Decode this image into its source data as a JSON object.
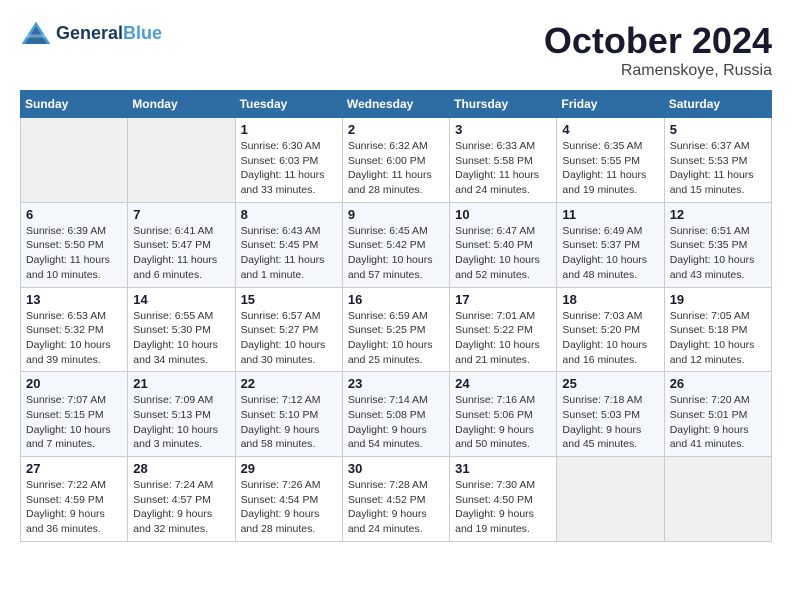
{
  "header": {
    "logo_line1": "General",
    "logo_line2": "Blue",
    "month": "October 2024",
    "location": "Ramenskoye, Russia"
  },
  "days_of_week": [
    "Sunday",
    "Monday",
    "Tuesday",
    "Wednesday",
    "Thursday",
    "Friday",
    "Saturday"
  ],
  "weeks": [
    [
      {
        "day": "",
        "empty": true
      },
      {
        "day": "",
        "empty": true
      },
      {
        "day": "1",
        "sunrise": "Sunrise: 6:30 AM",
        "sunset": "Sunset: 6:03 PM",
        "daylight": "Daylight: 11 hours and 33 minutes."
      },
      {
        "day": "2",
        "sunrise": "Sunrise: 6:32 AM",
        "sunset": "Sunset: 6:00 PM",
        "daylight": "Daylight: 11 hours and 28 minutes."
      },
      {
        "day": "3",
        "sunrise": "Sunrise: 6:33 AM",
        "sunset": "Sunset: 5:58 PM",
        "daylight": "Daylight: 11 hours and 24 minutes."
      },
      {
        "day": "4",
        "sunrise": "Sunrise: 6:35 AM",
        "sunset": "Sunset: 5:55 PM",
        "daylight": "Daylight: 11 hours and 19 minutes."
      },
      {
        "day": "5",
        "sunrise": "Sunrise: 6:37 AM",
        "sunset": "Sunset: 5:53 PM",
        "daylight": "Daylight: 11 hours and 15 minutes."
      }
    ],
    [
      {
        "day": "6",
        "sunrise": "Sunrise: 6:39 AM",
        "sunset": "Sunset: 5:50 PM",
        "daylight": "Daylight: 11 hours and 10 minutes."
      },
      {
        "day": "7",
        "sunrise": "Sunrise: 6:41 AM",
        "sunset": "Sunset: 5:47 PM",
        "daylight": "Daylight: 11 hours and 6 minutes."
      },
      {
        "day": "8",
        "sunrise": "Sunrise: 6:43 AM",
        "sunset": "Sunset: 5:45 PM",
        "daylight": "Daylight: 11 hours and 1 minute."
      },
      {
        "day": "9",
        "sunrise": "Sunrise: 6:45 AM",
        "sunset": "Sunset: 5:42 PM",
        "daylight": "Daylight: 10 hours and 57 minutes."
      },
      {
        "day": "10",
        "sunrise": "Sunrise: 6:47 AM",
        "sunset": "Sunset: 5:40 PM",
        "daylight": "Daylight: 10 hours and 52 minutes."
      },
      {
        "day": "11",
        "sunrise": "Sunrise: 6:49 AM",
        "sunset": "Sunset: 5:37 PM",
        "daylight": "Daylight: 10 hours and 48 minutes."
      },
      {
        "day": "12",
        "sunrise": "Sunrise: 6:51 AM",
        "sunset": "Sunset: 5:35 PM",
        "daylight": "Daylight: 10 hours and 43 minutes."
      }
    ],
    [
      {
        "day": "13",
        "sunrise": "Sunrise: 6:53 AM",
        "sunset": "Sunset: 5:32 PM",
        "daylight": "Daylight: 10 hours and 39 minutes."
      },
      {
        "day": "14",
        "sunrise": "Sunrise: 6:55 AM",
        "sunset": "Sunset: 5:30 PM",
        "daylight": "Daylight: 10 hours and 34 minutes."
      },
      {
        "day": "15",
        "sunrise": "Sunrise: 6:57 AM",
        "sunset": "Sunset: 5:27 PM",
        "daylight": "Daylight: 10 hours and 30 minutes."
      },
      {
        "day": "16",
        "sunrise": "Sunrise: 6:59 AM",
        "sunset": "Sunset: 5:25 PM",
        "daylight": "Daylight: 10 hours and 25 minutes."
      },
      {
        "day": "17",
        "sunrise": "Sunrise: 7:01 AM",
        "sunset": "Sunset: 5:22 PM",
        "daylight": "Daylight: 10 hours and 21 minutes."
      },
      {
        "day": "18",
        "sunrise": "Sunrise: 7:03 AM",
        "sunset": "Sunset: 5:20 PM",
        "daylight": "Daylight: 10 hours and 16 minutes."
      },
      {
        "day": "19",
        "sunrise": "Sunrise: 7:05 AM",
        "sunset": "Sunset: 5:18 PM",
        "daylight": "Daylight: 10 hours and 12 minutes."
      }
    ],
    [
      {
        "day": "20",
        "sunrise": "Sunrise: 7:07 AM",
        "sunset": "Sunset: 5:15 PM",
        "daylight": "Daylight: 10 hours and 7 minutes."
      },
      {
        "day": "21",
        "sunrise": "Sunrise: 7:09 AM",
        "sunset": "Sunset: 5:13 PM",
        "daylight": "Daylight: 10 hours and 3 minutes."
      },
      {
        "day": "22",
        "sunrise": "Sunrise: 7:12 AM",
        "sunset": "Sunset: 5:10 PM",
        "daylight": "Daylight: 9 hours and 58 minutes."
      },
      {
        "day": "23",
        "sunrise": "Sunrise: 7:14 AM",
        "sunset": "Sunset: 5:08 PM",
        "daylight": "Daylight: 9 hours and 54 minutes."
      },
      {
        "day": "24",
        "sunrise": "Sunrise: 7:16 AM",
        "sunset": "Sunset: 5:06 PM",
        "daylight": "Daylight: 9 hours and 50 minutes."
      },
      {
        "day": "25",
        "sunrise": "Sunrise: 7:18 AM",
        "sunset": "Sunset: 5:03 PM",
        "daylight": "Daylight: 9 hours and 45 minutes."
      },
      {
        "day": "26",
        "sunrise": "Sunrise: 7:20 AM",
        "sunset": "Sunset: 5:01 PM",
        "daylight": "Daylight: 9 hours and 41 minutes."
      }
    ],
    [
      {
        "day": "27",
        "sunrise": "Sunrise: 7:22 AM",
        "sunset": "Sunset: 4:59 PM",
        "daylight": "Daylight: 9 hours and 36 minutes."
      },
      {
        "day": "28",
        "sunrise": "Sunrise: 7:24 AM",
        "sunset": "Sunset: 4:57 PM",
        "daylight": "Daylight: 9 hours and 32 minutes."
      },
      {
        "day": "29",
        "sunrise": "Sunrise: 7:26 AM",
        "sunset": "Sunset: 4:54 PM",
        "daylight": "Daylight: 9 hours and 28 minutes."
      },
      {
        "day": "30",
        "sunrise": "Sunrise: 7:28 AM",
        "sunset": "Sunset: 4:52 PM",
        "daylight": "Daylight: 9 hours and 24 minutes."
      },
      {
        "day": "31",
        "sunrise": "Sunrise: 7:30 AM",
        "sunset": "Sunset: 4:50 PM",
        "daylight": "Daylight: 9 hours and 19 minutes."
      },
      {
        "day": "",
        "empty": true
      },
      {
        "day": "",
        "empty": true
      }
    ]
  ]
}
